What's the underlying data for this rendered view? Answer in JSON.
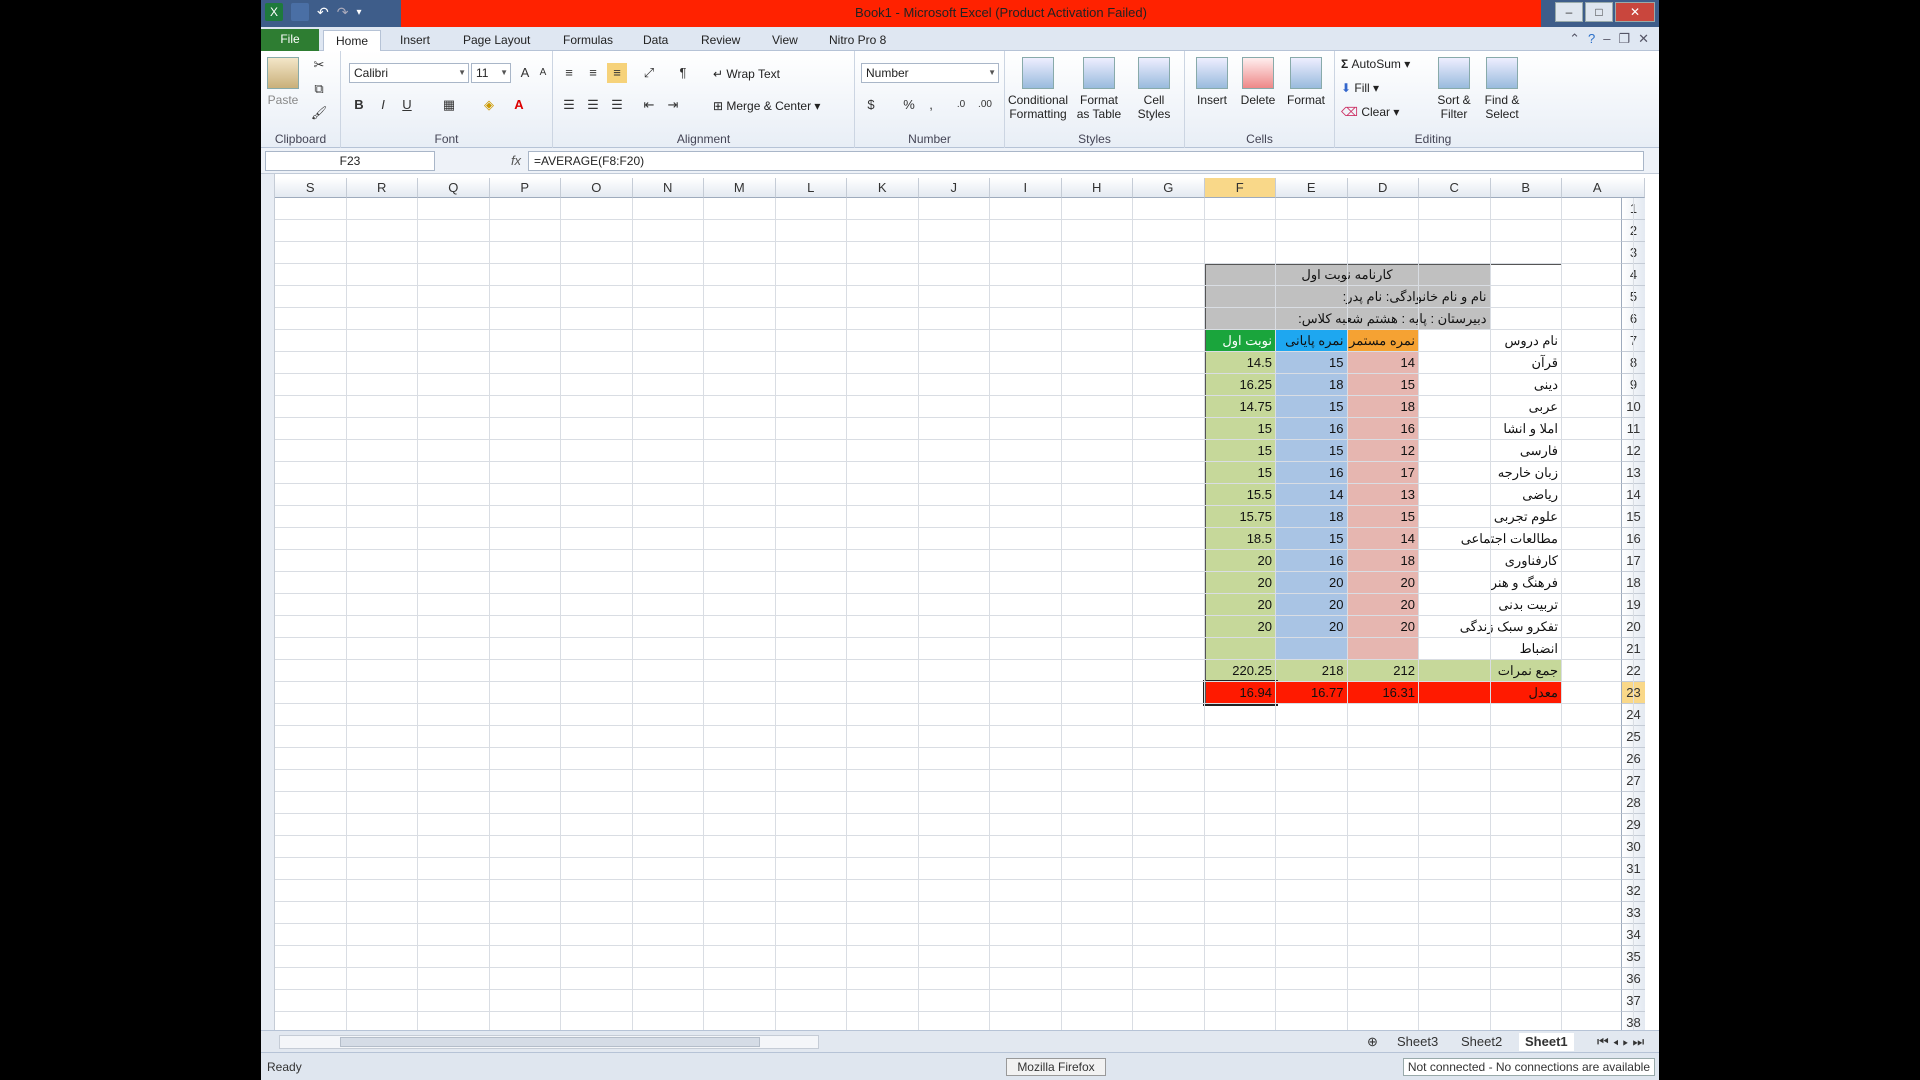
{
  "window": {
    "title": "Book1  -  Microsoft Excel (Product Activation Failed)",
    "controls": [
      "–",
      "□",
      "✕"
    ]
  },
  "tabs": {
    "file": "File",
    "home": "Home",
    "insert": "Insert",
    "page_layout": "Page Layout",
    "formulas": "Formulas",
    "data": "Data",
    "review": "Review",
    "view": "View",
    "nitro": "Nitro Pro 8"
  },
  "ribbon": {
    "clipboard": {
      "label": "Clipboard",
      "paste": "Paste"
    },
    "font": {
      "label": "Font",
      "name": "Calibri",
      "size": "11",
      "bold": "B",
      "italic": "I",
      "underline": "U"
    },
    "alignment": {
      "label": "Alignment",
      "wrap": "Wrap Text",
      "merge": "Merge & Center"
    },
    "number": {
      "label": "Number",
      "format": "Number",
      "percent": "%",
      "comma": ","
    },
    "styles": {
      "label": "Styles",
      "conditional": "Conditional\nFormatting",
      "format_table": "Format\nas Table",
      "cell_styles": "Cell\nStyles"
    },
    "cells": {
      "label": "Cells",
      "insert": "Insert",
      "delete": "Delete",
      "format": "Format"
    },
    "editing": {
      "label": "Editing",
      "autosum": "AutoSum",
      "fill": "Fill",
      "clear": "Clear",
      "sort": "Sort &\nFilter",
      "find": "Find &\nSelect"
    }
  },
  "formula_bar": {
    "name_box": "F23",
    "fx": "fx",
    "formula": "=AVERAGE(F8:F20)"
  },
  "columns": [
    "S",
    "R",
    "Q",
    "P",
    "O",
    "N",
    "M",
    "L",
    "K",
    "J",
    "I",
    "H",
    "G",
    "F",
    "E",
    "D",
    "C",
    "B",
    "A"
  ],
  "rows": [
    "1",
    "2",
    "3",
    "4",
    "5",
    "6",
    "7",
    "8",
    "9",
    "10",
    "11",
    "12",
    "13",
    "14",
    "15",
    "16",
    "17",
    "18",
    "19",
    "20",
    "21",
    "22",
    "23",
    "24",
    "25",
    "26",
    "27",
    "28",
    "29",
    "30",
    "31",
    "32",
    "33",
    "34",
    "35",
    "36",
    "37",
    "38"
  ],
  "report": {
    "title": "کارنامه نوبت اول",
    "line2": "نام و نام خانوادگی:     نام پدر:",
    "line3": "دبیرستان :       پایه : هشتم     شعبه کلاس:",
    "headers": {
      "c": "نام دروس",
      "d": "نمره مستمر",
      "e": "نمره پایانی",
      "f": "نوبت اول"
    },
    "rows": [
      {
        "c": "قرآن",
        "d": "14",
        "e": "15",
        "f": "14.5"
      },
      {
        "c": "دینی",
        "d": "15",
        "e": "18",
        "f": "16.25"
      },
      {
        "c": "عربی",
        "d": "18",
        "e": "15",
        "f": "14.75"
      },
      {
        "c": "املا و انشا",
        "d": "16",
        "e": "16",
        "f": "15"
      },
      {
        "c": "فارسی",
        "d": "12",
        "e": "15",
        "f": "15"
      },
      {
        "c": "زبان خارجه",
        "d": "17",
        "e": "16",
        "f": "15"
      },
      {
        "c": "ریاضی",
        "d": "13",
        "e": "14",
        "f": "15.5"
      },
      {
        "c": "علوم تجربی",
        "d": "15",
        "e": "18",
        "f": "15.75"
      },
      {
        "c": "مطالعات اجتماعی",
        "d": "14",
        "e": "15",
        "f": "18.5"
      },
      {
        "c": "کارفناوری",
        "d": "18",
        "e": "16",
        "f": "20"
      },
      {
        "c": "فرهنگ و هنر",
        "d": "20",
        "e": "20",
        "f": "20"
      },
      {
        "c": "تربیت بدنی",
        "d": "20",
        "e": "20",
        "f": "20"
      },
      {
        "c": "تفکرو سبک زندگی",
        "d": "20",
        "e": "20",
        "f": "20"
      },
      {
        "c": "انضباط",
        "d": "",
        "e": "",
        "f": ""
      }
    ],
    "sum": {
      "c": "جمع نمرات",
      "d": "212",
      "e": "218",
      "f": "220.25"
    },
    "avg": {
      "c": "معدل",
      "d": "16.31",
      "e": "16.77",
      "f": "16.94"
    }
  },
  "sheets": [
    "Sheet3",
    "Sheet2",
    "Sheet1"
  ],
  "status": {
    "ready": "Ready",
    "taskbar": "Mozilla Firefox",
    "connection": "Not connected - No connections are available"
  }
}
